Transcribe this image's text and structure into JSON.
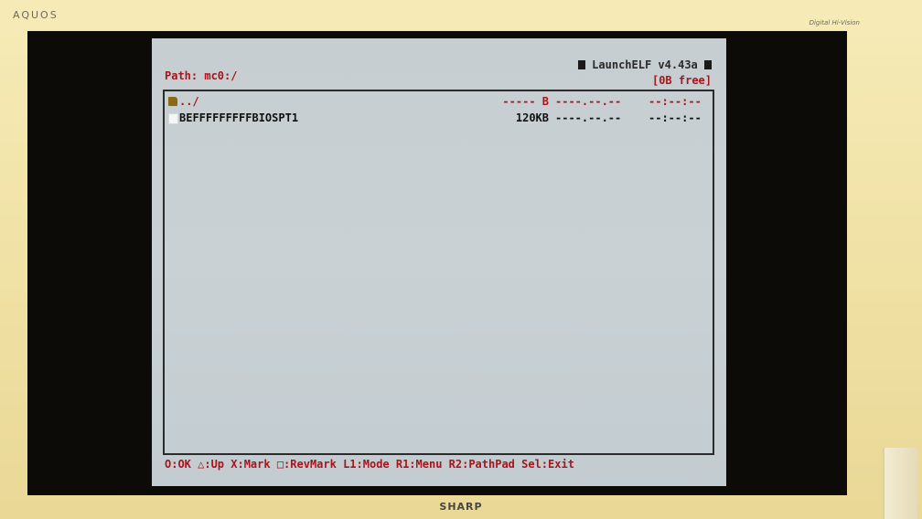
{
  "bezel": {
    "brand_top": "AQUOS",
    "tagline": "Digital Hi-Vision",
    "brand_bottom": "SHARP"
  },
  "app": {
    "title": "LaunchELF v4.43a",
    "path": "Path: mc0:/",
    "free_space": "[0B free]"
  },
  "files": [
    {
      "icon": "folder-icon",
      "name": "../",
      "size": "----- B",
      "date": "----.--.--",
      "time": "--:--:--"
    },
    {
      "icon": "file-icon",
      "name": "BEFFFFFFFFFBIOSPT1",
      "size": "120KB",
      "date": "----.--.--",
      "time": "--:--:--"
    }
  ],
  "help_bar": "O:OK △:Up X:Mark □:RevMark L1:Mode R1:Menu R2:PathPad Sel:Exit",
  "colors": {
    "accent_red": "#a8141c",
    "screen_bg": "#c6ced2",
    "bezel": "#efe2a6"
  }
}
